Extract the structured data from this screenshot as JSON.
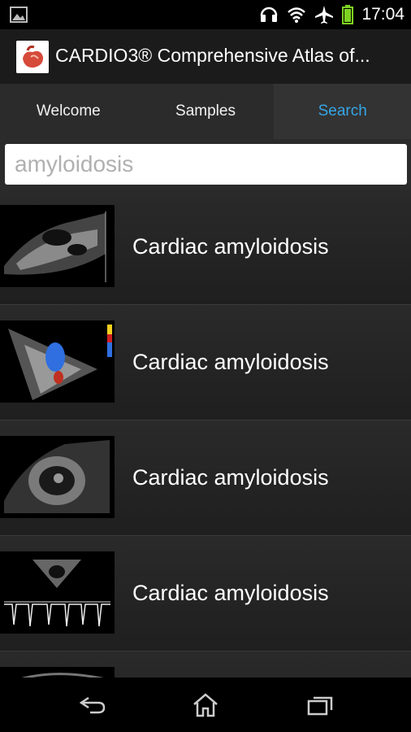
{
  "status": {
    "time": "17:04"
  },
  "app": {
    "title": "CARDIO3® Comprehensive Atlas of..."
  },
  "tabs": [
    {
      "label": "Welcome"
    },
    {
      "label": "Samples"
    },
    {
      "label": "Search"
    }
  ],
  "search": {
    "value": "amyloidosis"
  },
  "results": [
    {
      "label": "Cardiac amyloidosis"
    },
    {
      "label": "Cardiac amyloidosis"
    },
    {
      "label": "Cardiac amyloidosis"
    },
    {
      "label": "Cardiac amyloidosis"
    }
  ],
  "colors": {
    "accent": "#35a6e6",
    "battery": "#7ed321"
  },
  "icons": [
    "gallery-icon",
    "headset-icon",
    "wifi-icon",
    "airplane-icon",
    "battery-icon",
    "back-icon",
    "home-icon",
    "recents-icon"
  ]
}
